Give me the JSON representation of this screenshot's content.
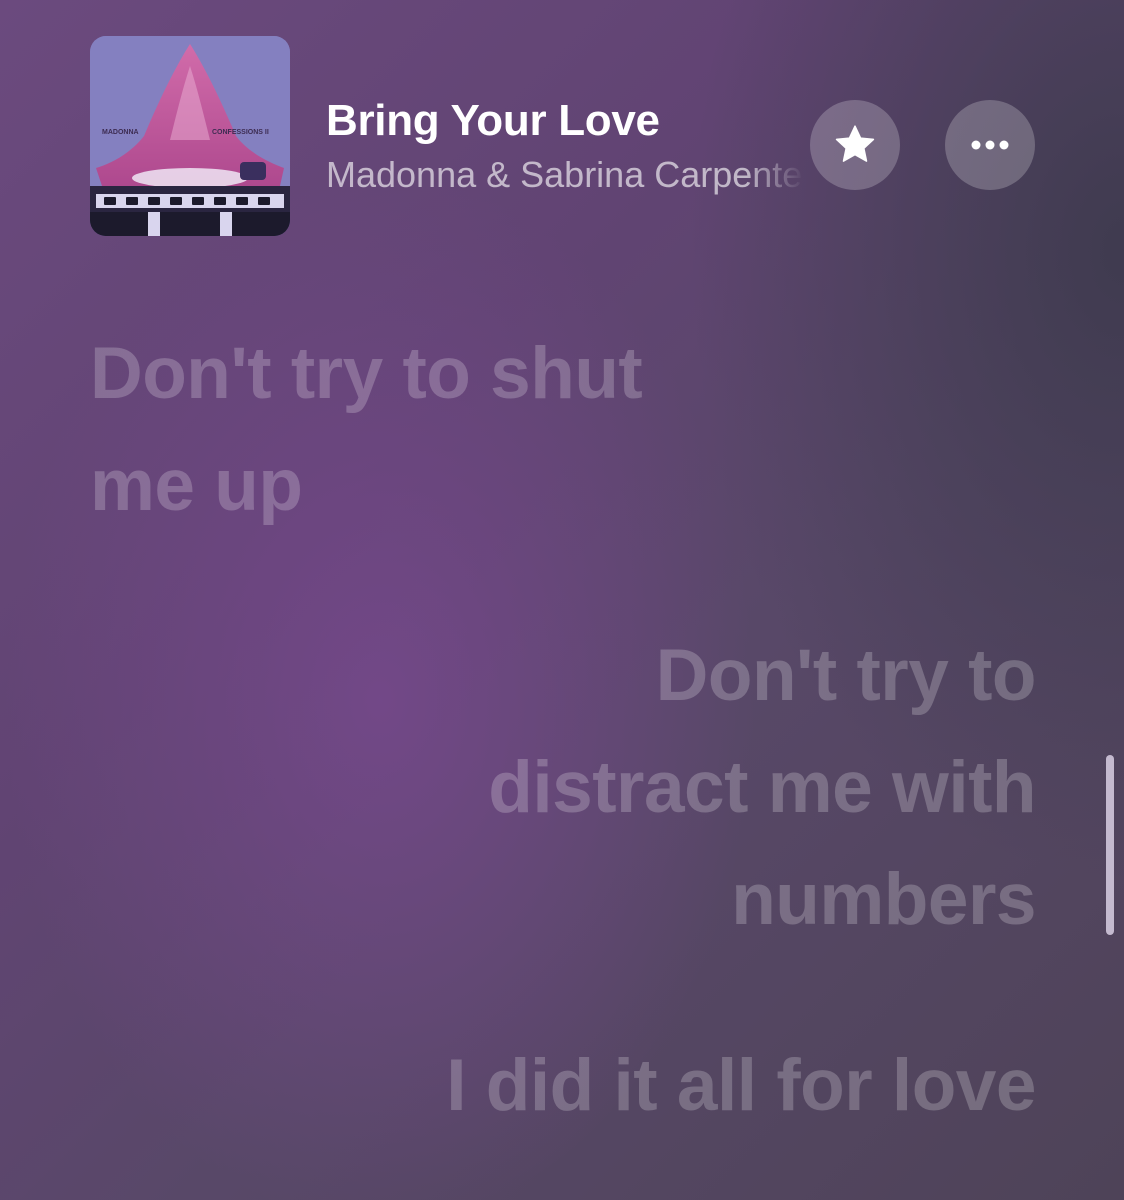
{
  "now_playing": {
    "title": "Bring Your Love",
    "artist": "Madonna & Sabrina Carpenter",
    "artwork": {
      "left_text": "MADONNA",
      "right_text": "CONFESSIONS II"
    }
  },
  "controls": {
    "favorite_icon": "star-icon",
    "more_icon": "ellipsis-icon"
  },
  "lyrics": [
    {
      "lines": [
        "Don't try to shut",
        "me up"
      ]
    },
    {
      "lines": [
        "Don't try to",
        "distract me with",
        "numbers"
      ]
    },
    {
      "lines": [
        "I did it all for love"
      ]
    }
  ],
  "colors": {
    "background_purple": "#614473",
    "background_slate": "#4e4358",
    "lyric_inactive": "rgba(255,255,255,0.22)"
  }
}
